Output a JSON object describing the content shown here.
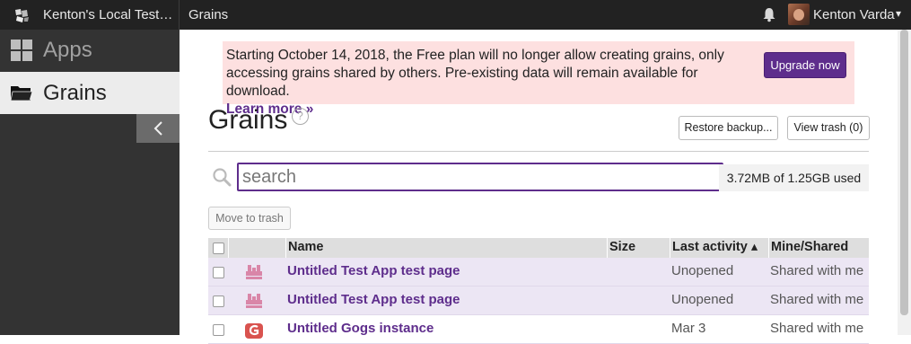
{
  "topbar": {
    "server_name": "Kenton's Local Test…",
    "breadcrumb": "Grains",
    "user_name": "Kenton Varda",
    "user_caret": "▾"
  },
  "sidebar": {
    "items": [
      {
        "label": "Apps",
        "icon": "apps-grid-icon"
      },
      {
        "label": "Grains",
        "icon": "folder-icon",
        "active": true
      }
    ]
  },
  "banner": {
    "text": "Starting October 14, 2018, the Free plan will no longer allow creating grains, only accessing grains shared by others. Pre-existing data will remain available for download.",
    "learn_more": "Learn more »",
    "upgrade_label": "Upgrade now",
    "background_color": "#fde0e0",
    "accent_color": "#5e2d8c"
  },
  "page": {
    "title": "Grains",
    "help": "?",
    "restore_label": "Restore backup...",
    "view_trash_label": "View trash (0)"
  },
  "search": {
    "placeholder": "search",
    "value": ""
  },
  "storage": {
    "usage": "3.72MB of 1.25GB used"
  },
  "actions": {
    "move_to_trash": "Move to trash"
  },
  "table": {
    "columns": [
      "Name",
      "Size",
      "Last activity ▴",
      "Mine/Shared"
    ],
    "rows": [
      {
        "name": "Untitled Test App test page",
        "size": "",
        "last_activity": "Unopened",
        "mine_shared": "Shared with me",
        "icon": "test-app-icon"
      },
      {
        "name": "Untitled Test App test page",
        "size": "",
        "last_activity": "Unopened",
        "mine_shared": "Shared with me",
        "icon": "test-app-icon"
      },
      {
        "name": "Untitled Gogs instance",
        "size": "",
        "last_activity": "Mar 3",
        "mine_shared": "Shared with me",
        "icon": "gogs-icon"
      }
    ]
  }
}
